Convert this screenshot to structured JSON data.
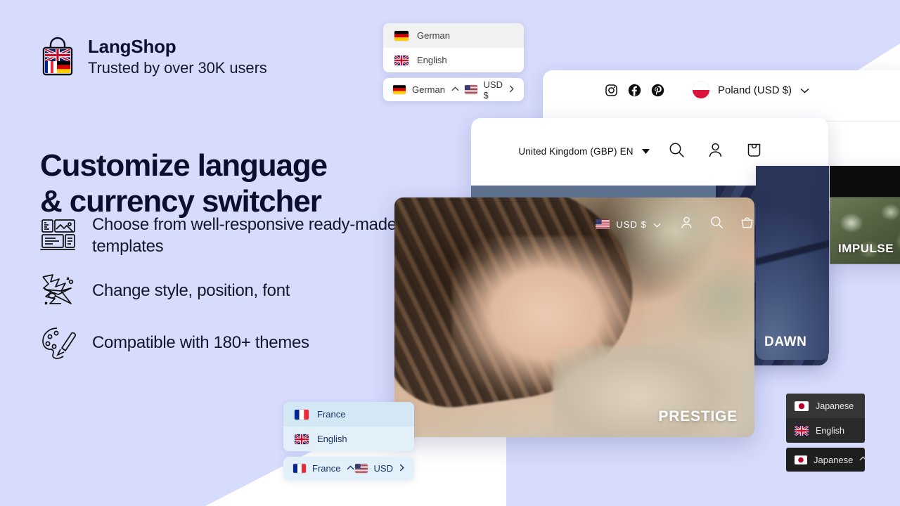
{
  "colors": {
    "background": "#d7dcfd",
    "headline": "#0b0e2c",
    "white": "#ffffff",
    "dark_widget_bg": "#2a2a2a",
    "france_widget_bg": "#e2f0fa",
    "france_widget_text": "#17306b"
  },
  "brand": {
    "name": "LangShop",
    "tagline": "Trusted by over 30K users",
    "icon": "shopping-bag-flags-icon"
  },
  "headline": {
    "line1": "Customize language",
    "line2": "& currency switcher"
  },
  "features": [
    {
      "icon": "templates-icon",
      "text": "Choose from well-responsive ready-made templates"
    },
    {
      "icon": "style-position-font-icon",
      "text": "Change style, position, font"
    },
    {
      "icon": "palette-brush-icon",
      "text": "Compatible with 180+ themes"
    }
  ],
  "switcher_german": {
    "options": [
      {
        "flag": "de-flag",
        "label": "German",
        "selected": true
      },
      {
        "flag": "gb-flag",
        "label": "English",
        "selected": false
      }
    ],
    "bar": {
      "language_flag": "de-flag",
      "language_label": "German",
      "language_chevron": "chevron-up-icon",
      "currency_flag": "us-flag",
      "currency_label": "USD $",
      "currency_chevron": "chevron-right-icon"
    }
  },
  "switcher_france": {
    "options": [
      {
        "flag": "fr-flag",
        "label": "France",
        "selected": true
      },
      {
        "flag": "gb-flag",
        "label": "English",
        "selected": false
      }
    ],
    "bar": {
      "language_flag": "fr-flag",
      "language_label": "France",
      "language_chevron": "chevron-up-icon",
      "currency_flag": "us-flag",
      "currency_label": "USD",
      "currency_chevron": "chevron-right-icon"
    }
  },
  "switcher_japanese": {
    "options": [
      {
        "flag": "jp-flag",
        "label": "Japanese",
        "selected": true
      },
      {
        "flag": "gb-flag",
        "label": "English",
        "selected": false
      }
    ],
    "bar": {
      "language_flag": "jp-flag",
      "language_label": "Japanese",
      "language_chevron": "chevron-up-icon"
    }
  },
  "card_poland": {
    "social": [
      "instagram-icon",
      "facebook-icon",
      "pinterest-icon"
    ],
    "country_flag": "pl-flag-round",
    "country_label": "Poland (USD $)",
    "chevron": "chevron-down-icon"
  },
  "card_uk": {
    "selector_label": "United Kingdom (GBP) EN",
    "caret": "caret-down-icon",
    "icons": [
      "search-icon",
      "account-icon",
      "cart-icon"
    ]
  },
  "card_dawn": {
    "label": "DAWN"
  },
  "card_impulse": {
    "label": "IMPULSE"
  },
  "card_prestige": {
    "label": "PRESTIGE",
    "currency_flag": "us-flag",
    "currency_label": "USD $",
    "chevron": "chevron-down-icon",
    "icons": [
      "account-icon",
      "search-icon",
      "basket-icon"
    ]
  }
}
